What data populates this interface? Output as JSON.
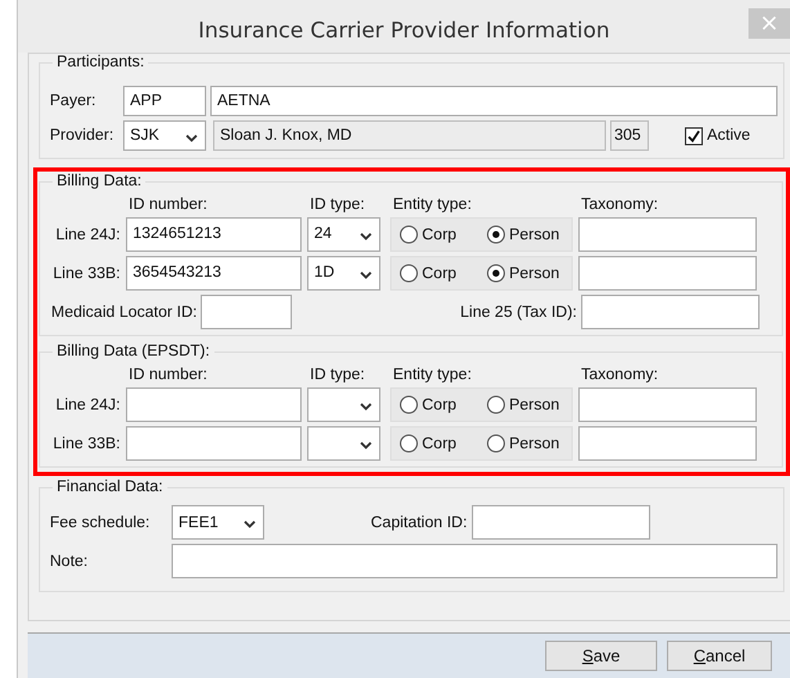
{
  "window": {
    "title": "Insurance Carrier Provider Information",
    "close": "×"
  },
  "participants": {
    "title": "Participants:",
    "payer": {
      "label": "Payer:",
      "code": "APP",
      "name": "AETNA"
    },
    "provider": {
      "label": "Provider:",
      "code": "SJK",
      "name": "Sloan J. Knox, MD",
      "number": "305"
    },
    "active": {
      "label": "Active",
      "checked": true
    }
  },
  "billing_section": {
    "highlighted": true,
    "groups": [
      {
        "title": "Billing Data:",
        "columns": [
          "ID number:",
          "ID type:",
          "Entity type:",
          "Taxonomy:"
        ],
        "rows": [
          {
            "label": "Line 24J:",
            "id_number": "1324651213",
            "id_type": "24",
            "entity_options": [
              {
                "label": "Corp",
                "selected": false
              },
              {
                "label": "Person",
                "selected": true
              }
            ]
          },
          {
            "label": "Line 33B:",
            "id_number": "3654543213",
            "id_type": "1D",
            "entity_options": [
              {
                "label": "Corp",
                "selected": false
              },
              {
                "label": "Person",
                "selected": true
              }
            ]
          }
        ],
        "medicaid_label": "Medicaid Locator ID:",
        "tax_id_label": "Line 25 (Tax ID):"
      },
      {
        "title": "Billing Data (EPSDT):",
        "columns": [
          "ID number:",
          "ID type:",
          "Entity type:",
          "Taxonomy:"
        ],
        "rows": [
          {
            "label": "Line 24J:",
            "entity_options": [
              {
                "label": "Corp",
                "selected": false
              },
              {
                "label": "Person",
                "selected": false
              }
            ]
          },
          {
            "label": "Line 33B:",
            "entity_options": [
              {
                "label": "Corp",
                "selected": false
              },
              {
                "label": "Person",
                "selected": false
              }
            ]
          }
        ]
      }
    ]
  },
  "financial": {
    "title": "Financial Data:",
    "fee_schedule": {
      "label": "Fee schedule:",
      "value": "FEE1"
    },
    "capitation": {
      "label": "Capitation ID:"
    },
    "note": {
      "label": "Note:"
    }
  },
  "buttons": [
    {
      "label": "Save"
    },
    {
      "label": "Cancel"
    }
  ]
}
